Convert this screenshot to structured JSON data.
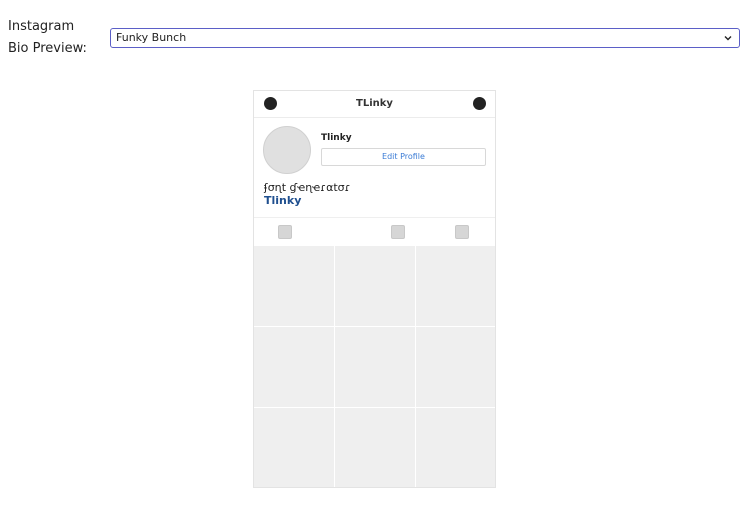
{
  "form": {
    "label": "Instagram Bio Preview:",
    "select_value": "Funky Bunch"
  },
  "preview": {
    "header_title": "TLinky",
    "username": "Tlinky",
    "edit_profile_label": "Edit Profile",
    "bio_text": "ʄσɳt ɠҽɳҽɾαtσɾ",
    "bio_link": "Tlinky",
    "tabs": [
      "grid-tab",
      "reels-tab",
      "tagged-tab"
    ],
    "grid_cells": 9
  },
  "colors": {
    "select_border": "#5b5fc7",
    "link": "#1f4f8f",
    "edit_button_text": "#3a7bd5",
    "placeholder": "#efefef"
  }
}
